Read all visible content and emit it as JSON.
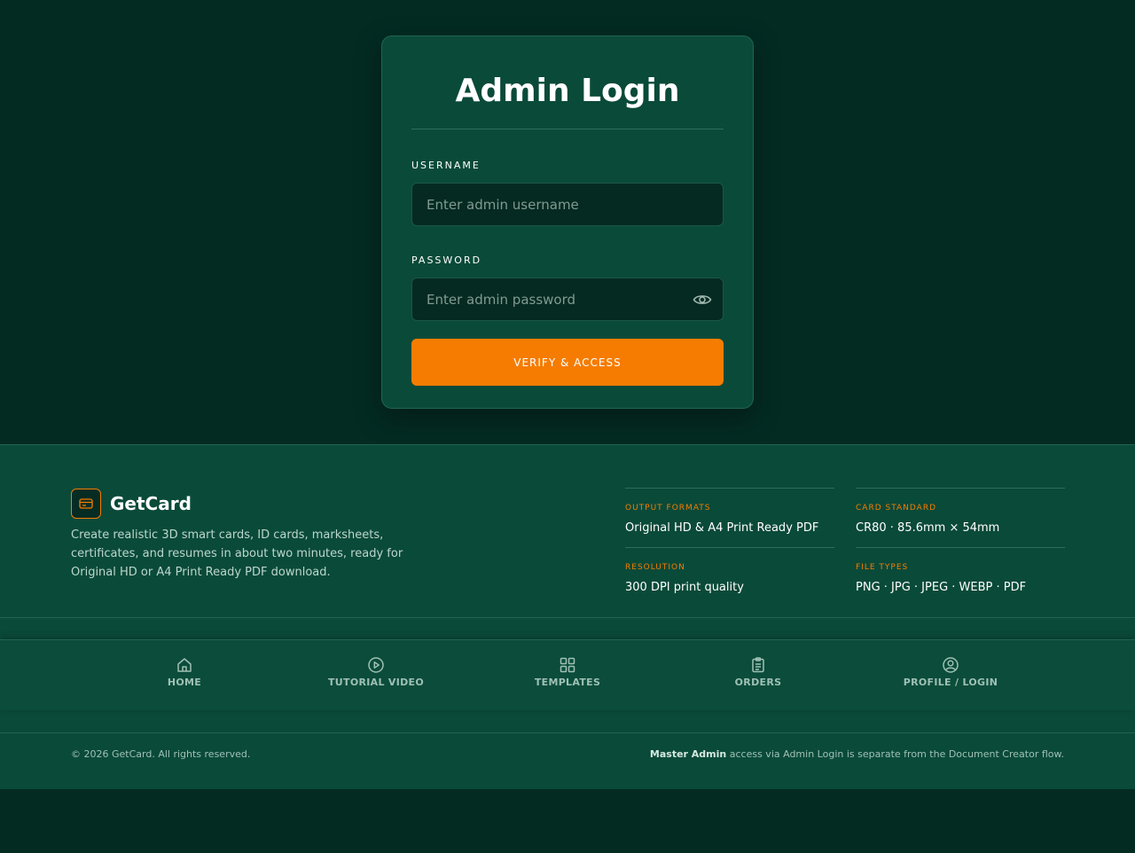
{
  "login": {
    "title": "Admin Login",
    "username_label": "Username",
    "username_placeholder": "Enter admin username",
    "username_value": "",
    "password_label": "Password",
    "password_placeholder": "Enter admin password",
    "password_value": "",
    "submit_label": "Verify & Access"
  },
  "footer": {
    "brand": "GetCard",
    "description": "Create realistic 3D smart cards, ID cards, marksheets, certificates, and resumes in about two minutes, ready for Original HD or A4 Print Ready PDF download.",
    "specs": [
      {
        "label": "Output Formats",
        "value": "Original HD & A4 Print Ready PDF"
      },
      {
        "label": "Card Standard",
        "value": "CR80 · 85.6mm × 54mm"
      },
      {
        "label": "Resolution",
        "value": "300 DPI print quality"
      },
      {
        "label": "File Types",
        "value": "PNG · JPG · JPEG · WEBP · PDF"
      }
    ],
    "nav": [
      {
        "label": "Home",
        "icon": "home-icon"
      },
      {
        "label": "Tutorial Video",
        "icon": "play-circle-icon"
      },
      {
        "label": "Templates",
        "icon": "grid-icon"
      },
      {
        "label": "Orders",
        "icon": "clipboard-icon"
      },
      {
        "label": "Profile / Login",
        "icon": "user-circle-icon"
      }
    ],
    "copyright": "© 2026 GetCard. All rights reserved.",
    "admin_note_strong": "Master Admin",
    "admin_note_rest": " access via Admin Login is separate from the Document Creator flow."
  },
  "colors": {
    "background": "#032b22",
    "panel": "#0a4a39",
    "accent": "#f57c00"
  }
}
